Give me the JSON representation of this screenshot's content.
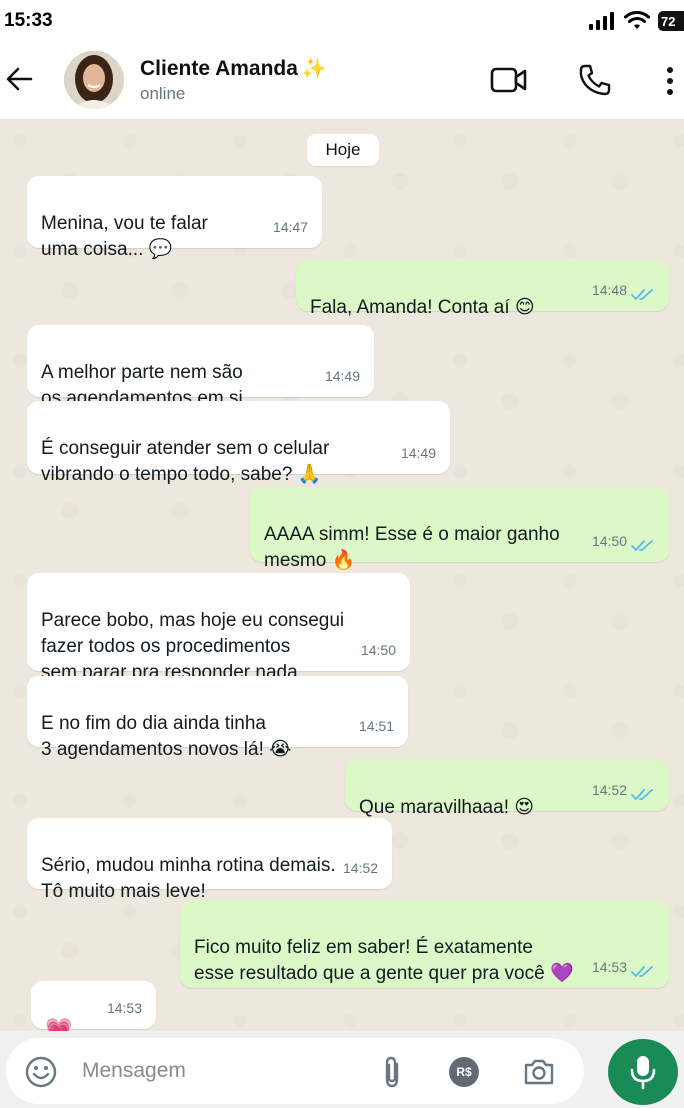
{
  "status_bar": {
    "time": "15:33",
    "battery": "72"
  },
  "header": {
    "contact_name": "Cliente Amanda",
    "sparkle": "✨",
    "status": "online"
  },
  "chat": {
    "date_label": "Hoje",
    "messages": [
      {
        "direction": "in",
        "text": "Menina, vou te falar\numa coisa... 💬",
        "time": "14:47"
      },
      {
        "direction": "out",
        "text": "Fala, Amanda! Conta aí 😊",
        "time": "14:48",
        "read": true
      },
      {
        "direction": "in",
        "text": "A melhor parte nem são\nos agendamentos em si...",
        "time": "14:49"
      },
      {
        "direction": "in",
        "text": "É conseguir atender sem o celular\nvibrando o tempo todo, sabe? 🙏",
        "time": "14:49"
      },
      {
        "direction": "out",
        "text": "AAAA simm! Esse é o maior ganho\nmesmo 🔥",
        "time": "14:50",
        "read": true
      },
      {
        "direction": "in",
        "text": "Parece bobo, mas hoje eu consegui\nfazer todos os procedimentos\nsem parar pra responder nada",
        "time": "14:50"
      },
      {
        "direction": "in",
        "text": "E no fim do dia ainda tinha\n3 agendamentos novos lá! 😭",
        "time": "14:51"
      },
      {
        "direction": "out",
        "text": "Que maravilhaaa! 😍",
        "time": "14:52",
        "read": true
      },
      {
        "direction": "in",
        "text": "Sério, mudou minha rotina demais.\nTô muito mais leve!",
        "time": "14:52"
      },
      {
        "direction": "out",
        "text": "Fico muito feliz em saber! É exatamente\nesse resultado que a gente quer pra você 💜",
        "time": "14:53",
        "read": true
      },
      {
        "direction": "in",
        "text": "💗",
        "time": "14:53"
      }
    ]
  },
  "composer": {
    "placeholder": "Mensagem",
    "currency_label": "R$"
  },
  "colors": {
    "incoming_bubble": "#ffffff",
    "outgoing_bubble": "#dcf8c6",
    "read_ticks": "#53bdeb",
    "mic_button": "#1a8a57"
  }
}
